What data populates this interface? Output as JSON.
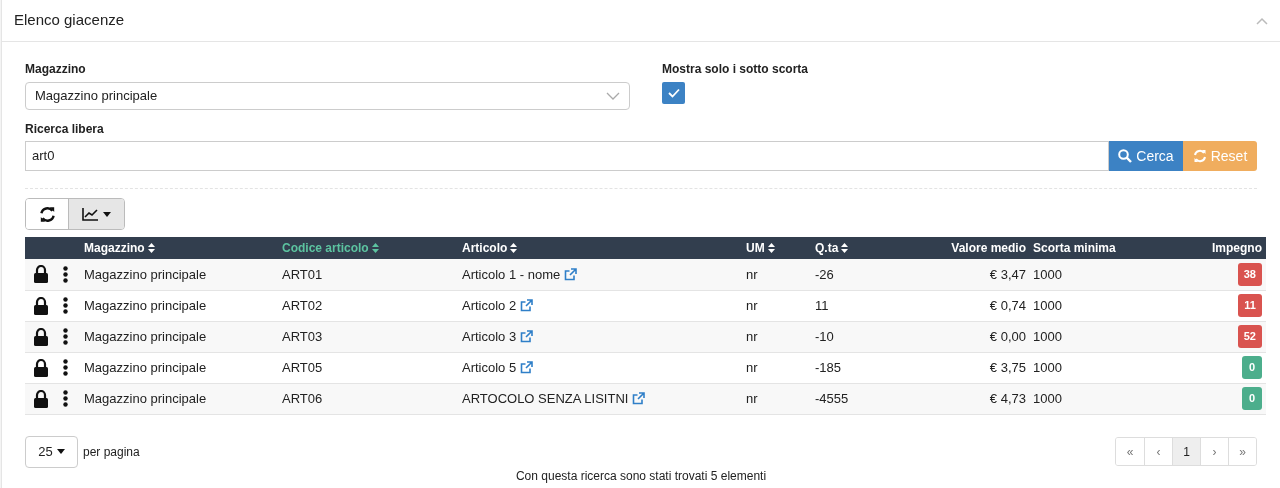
{
  "panel": {
    "title": "Elenco giacenze"
  },
  "filters": {
    "warehouse": {
      "label": "Magazzino",
      "value": "Magazzino principale"
    },
    "under_stock": {
      "label": "Mostra solo i sotto scorta",
      "checked": true
    },
    "search": {
      "label": "Ricerca libera",
      "value": "art0"
    },
    "buttons": [
      {
        "kind": "search",
        "label": "Cerca"
      },
      {
        "kind": "reset",
        "label": "Reset"
      }
    ]
  },
  "table": {
    "columns": [
      {
        "label": "Magazzino",
        "sortable": true,
        "sorted": false
      },
      {
        "label": "Codice articolo",
        "sortable": true,
        "sorted": true
      },
      {
        "label": "Articolo",
        "sortable": true,
        "sorted": false
      },
      {
        "label": "UM",
        "sortable": true,
        "sorted": false
      },
      {
        "label": "Q.ta",
        "sortable": true,
        "sorted": false
      },
      {
        "label": "Valore medio",
        "sortable": false,
        "sorted": false
      },
      {
        "label": "Scorta minima",
        "sortable": false,
        "sorted": false
      },
      {
        "label": "Impegno",
        "sortable": false,
        "sorted": false
      }
    ],
    "rows": [
      {
        "warehouse": "Magazzino principale",
        "code": "ART01",
        "article": "Articolo 1 - nome",
        "um": "nr",
        "qty": "-26",
        "avg_value": "€ 3,47",
        "min_stock": "1000",
        "commitment": "38",
        "color": "#d9534f"
      },
      {
        "warehouse": "Magazzino principale",
        "code": "ART02",
        "article": "Articolo 2",
        "um": "nr",
        "qty": "11",
        "avg_value": "€ 0,74",
        "min_stock": "1000",
        "commitment": "11",
        "color": "#d9534f"
      },
      {
        "warehouse": "Magazzino principale",
        "code": "ART03",
        "article": "Articolo 3",
        "um": "nr",
        "qty": "-10",
        "avg_value": "€ 0,00",
        "min_stock": "1000",
        "commitment": "52",
        "color": "#d9534f"
      },
      {
        "warehouse": "Magazzino principale",
        "code": "ART05",
        "article": "Articolo 5",
        "um": "nr",
        "qty": "-185",
        "avg_value": "€ 3,75",
        "min_stock": "1000",
        "commitment": "0",
        "color": "#4cae8c"
      },
      {
        "warehouse": "Magazzino principale",
        "code": "ART06",
        "article": "ARTOCOLO SENZA LISITNI",
        "um": "nr",
        "qty": "-4555",
        "avg_value": "€ 4,73",
        "min_stock": "1000",
        "commitment": "0",
        "color": "#4cae8c"
      }
    ]
  },
  "page_size": {
    "value": "25",
    "label": "per pagina"
  },
  "pagination": [
    {
      "label": "«",
      "selected": false
    },
    {
      "label": "‹",
      "selected": false
    },
    {
      "label": "1",
      "selected": true
    },
    {
      "label": "›",
      "selected": false
    },
    {
      "label": "»",
      "selected": false
    }
  ],
  "summary": "Con questa ricerca sono stati trovati 5 elementi"
}
